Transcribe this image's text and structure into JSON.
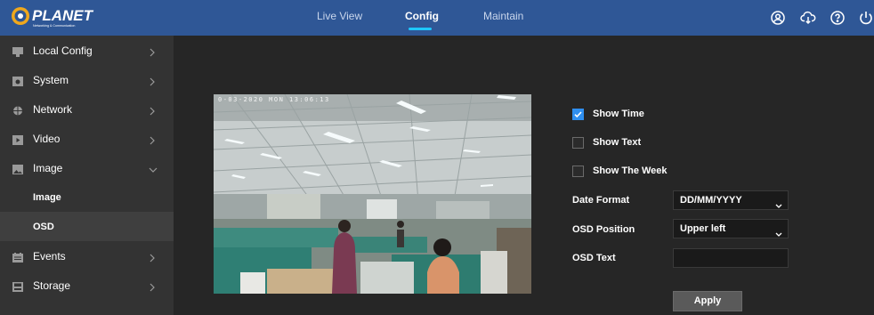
{
  "brand": {
    "logo_text": "PLANET",
    "logo_subtext": "Networking & Communication"
  },
  "topnav": {
    "tabs": [
      {
        "label": "Live View",
        "active": false
      },
      {
        "label": "Config",
        "active": true
      },
      {
        "label": "Maintain",
        "active": false
      }
    ],
    "icons": [
      "user-icon",
      "cloud-download-icon",
      "help-icon",
      "power-icon"
    ]
  },
  "sidebar": {
    "items": [
      {
        "label": "Local Config",
        "icon": "monitor-icon",
        "chevron": "right"
      },
      {
        "label": "System",
        "icon": "system-icon",
        "chevron": "right"
      },
      {
        "label": "Network",
        "icon": "network-icon",
        "chevron": "right"
      },
      {
        "label": "Video",
        "icon": "video-icon",
        "chevron": "right"
      },
      {
        "label": "Image",
        "icon": "image-icon",
        "chevron": "down"
      },
      {
        "label": "Image",
        "sub": true
      },
      {
        "label": "OSD",
        "sub": true,
        "selected": true
      },
      {
        "label": "Events",
        "icon": "events-icon",
        "chevron": "right"
      },
      {
        "label": "Storage",
        "icon": "storage-icon",
        "chevron": "right"
      }
    ]
  },
  "preview": {
    "osd_overlay": "0-03-2020 MON 13:06:13"
  },
  "osd": {
    "show_time": {
      "label": "Show Time",
      "checked": true
    },
    "show_text": {
      "label": "Show Text",
      "checked": false
    },
    "show_week": {
      "label": "Show The Week",
      "checked": false
    },
    "date_format": {
      "label": "Date Format",
      "value": "DD/MM/YYYY"
    },
    "osd_position": {
      "label": "OSD Position",
      "value": "Upper left"
    },
    "osd_text": {
      "label": "OSD Text",
      "value": ""
    },
    "apply_label": "Apply"
  },
  "colors": {
    "topbar": "#2f5796",
    "sidebar": "#333333",
    "background": "#262626",
    "accent": "#1ec8ff",
    "checkbox": "#2f8ff0"
  }
}
